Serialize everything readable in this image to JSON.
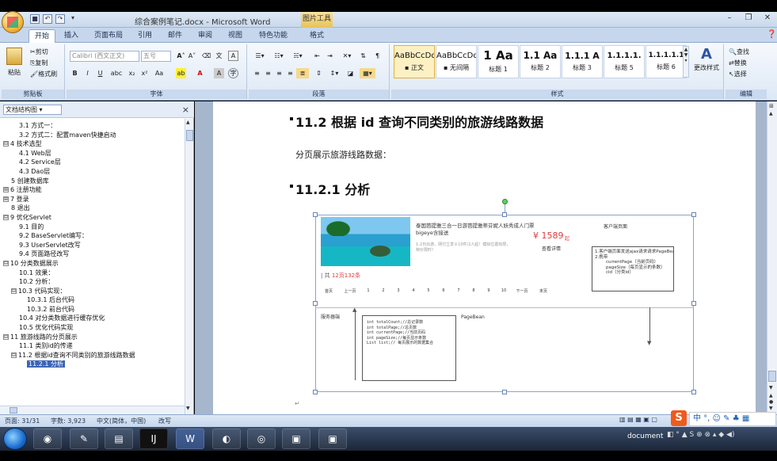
{
  "window": {
    "title": "综合案例笔记.docx - Microsoft Word",
    "context_tab": "图片工具",
    "context_sub_tab": "格式"
  },
  "quick_access": {
    "save": "■",
    "undo": "↶",
    "redo": "↷",
    "more": "▾"
  },
  "tabs": [
    "开始",
    "插入",
    "页面布局",
    "引用",
    "邮件",
    "审阅",
    "视图",
    "特色功能",
    "格式"
  ],
  "ribbon": {
    "clipboard": {
      "label": "剪贴板",
      "paste": "粘贴",
      "cut": "剪切",
      "copy": "复制",
      "format_painter": "格式刷"
    },
    "font": {
      "label": "字体",
      "font_name": "Calibri (西文正文)",
      "font_size": "五号"
    },
    "paragraph": {
      "label": "段落"
    },
    "styles": {
      "label": "样式",
      "items": [
        {
          "sample": "AaBbCcDd",
          "name": "▪ 正文"
        },
        {
          "sample": "AaBbCcDd",
          "name": "▪ 无间隔"
        },
        {
          "sample": "1  Aa",
          "name": "标题 1"
        },
        {
          "sample": "1.1  Aa",
          "name": "标题 2"
        },
        {
          "sample": "1.1.1  A",
          "name": "标题 3"
        },
        {
          "sample": "1.1.1.1.",
          "name": "标题 5"
        },
        {
          "sample": "1.1.1.1.1",
          "name": "标题 6"
        }
      ],
      "change_styles": "更改样式"
    },
    "editing": {
      "label": "编辑",
      "find": "查找",
      "replace": "替换",
      "select": "选择"
    }
  },
  "nav": {
    "dropdown": "文档结构图",
    "close": "×",
    "items": [
      {
        "text": "3.1    方式一：",
        "level": 3,
        "exp": ""
      },
      {
        "text": "3.2 方式二：配置maven快捷启动",
        "level": 3,
        "exp": ""
      },
      {
        "text": "4 技术选型",
        "level": 1,
        "exp": "⊟"
      },
      {
        "text": "4.1 Web层",
        "level": 3,
        "exp": ""
      },
      {
        "text": "4.2 Service层",
        "level": 3,
        "exp": ""
      },
      {
        "text": "4.3 Dao层",
        "level": 3,
        "exp": ""
      },
      {
        "text": "5 创建数据库",
        "level": 2,
        "exp": ""
      },
      {
        "text": "6 注册功能",
        "level": 1,
        "exp": "⊞"
      },
      {
        "text": "7 登录",
        "level": 1,
        "exp": "⊞"
      },
      {
        "text": "8 退出",
        "level": 2,
        "exp": ""
      },
      {
        "text": "9 优化Servlet",
        "level": 1,
        "exp": "⊟"
      },
      {
        "text": "9.1 目的",
        "level": 3,
        "exp": ""
      },
      {
        "text": "9.2 BaseServlet编写：",
        "level": 3,
        "exp": ""
      },
      {
        "text": "9.3 UserServlet改写",
        "level": 3,
        "exp": ""
      },
      {
        "text": "9.4 页面路径改写",
        "level": 3,
        "exp": ""
      },
      {
        "text": "10 分类数据展示",
        "level": 1,
        "exp": "⊟"
      },
      {
        "text": "10.1 效果：",
        "level": 3,
        "exp": ""
      },
      {
        "text": "10.2    分析：",
        "level": 3,
        "exp": ""
      },
      {
        "text": "10.3 代码实现：",
        "level": 2,
        "exp": "⊟"
      },
      {
        "text": "10.3.1 后台代码",
        "level": 4,
        "exp": ""
      },
      {
        "text": "10.3.2 前台代码",
        "level": 4,
        "exp": ""
      },
      {
        "text": "10.4 对分类数据进行缓存优化",
        "level": 3,
        "exp": ""
      },
      {
        "text": "10.5 优化代码实现",
        "level": 3,
        "exp": ""
      },
      {
        "text": "11 旅游线路的分页展示",
        "level": 1,
        "exp": "⊟"
      },
      {
        "text": "11.1 类别id的传递",
        "level": 3,
        "exp": ""
      },
      {
        "text": "11.2 根据id查询不同类别的旅游线路数据",
        "level": 2,
        "exp": "⊟"
      },
      {
        "text": "11.2.1 分析",
        "level": 4,
        "exp": "",
        "selected": true
      }
    ]
  },
  "document": {
    "heading1": "11.2  根据 id 查询不同类别的旅游线路数据",
    "para1": "分页展示旅游线路数据：",
    "heading2": "11.2.1  分析"
  },
  "figure": {
    "product_title": "泰国芭提雅三合一日游芭提雅蒂芬妮人妖秀成人门票bigeye含接送",
    "product_desc": "1-2日出游，网付立享￥10件/2人起！模拟位置有限，特价限时！",
    "price": "¥ 1589",
    "price_unit": "起",
    "detail": "查看详情",
    "total_prefix": "共",
    "total_pages": "12页",
    "total_count": "132条",
    "pager": [
      "首页",
      "上一页",
      "1",
      "2",
      "3",
      "4",
      "5",
      "6",
      "7",
      "8",
      "9",
      "10",
      "下一页",
      "末页"
    ],
    "client_label": "客户端页面",
    "client_note": "1.客户端页面发送ajax请求请求PageBean数据\n2.携带\n        currentPage（当前页码）\n        pageSize（每页显示的条数）\n        cid（分类id）",
    "server_label": "服务器端",
    "pagebean_label": "PageBean",
    "pagebean_fields": "int totalCount;//总记录数\nint totalPage;//总页数\nint currentPage;//当前页码\nint pageSize;//每页显示条数\nList list;// 每页展示的数据集合"
  },
  "status": {
    "page": "页面: 31/31",
    "words": "字数: 3,923",
    "lang": "中文(简体，中国)",
    "mode": "改写"
  },
  "taskbar": {
    "app_label": "document",
    "ime": "中",
    "icons": [
      "ie-icon",
      "word-icon",
      "explorer-icon",
      "intellij-icon",
      "word-doc-icon",
      "eclipse-icon",
      "chrome-icon",
      "window1-icon",
      "window2-icon"
    ]
  },
  "colors": {
    "accent": "#3c64b4",
    "price": "#e23c3c",
    "total": "#e23c3c"
  }
}
